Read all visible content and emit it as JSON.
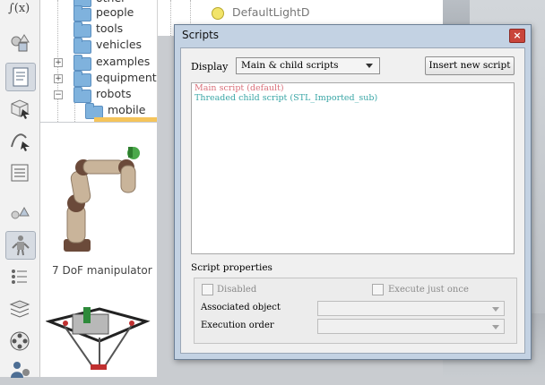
{
  "toolbar": {
    "items": [
      {
        "name": "script-function-icon",
        "label": "∫(x)"
      },
      {
        "name": "shapes-icon"
      },
      {
        "name": "script-page-icon"
      },
      {
        "name": "cube-select-icon"
      },
      {
        "name": "path-icon"
      },
      {
        "name": "properties-icon"
      },
      {
        "name": "primitives-icon"
      },
      {
        "name": "robot-icon"
      },
      {
        "name": "list-icon"
      },
      {
        "name": "layers-icon"
      },
      {
        "name": "film-icon"
      },
      {
        "name": "user-settings-icon"
      }
    ]
  },
  "tree": {
    "items": [
      {
        "label": "other",
        "expander": ""
      },
      {
        "label": "people",
        "expander": ""
      },
      {
        "label": "tools",
        "expander": ""
      },
      {
        "label": "vehicles",
        "expander": ""
      },
      {
        "label": "examples",
        "expander": "+"
      },
      {
        "label": "equipment",
        "expander": "+"
      },
      {
        "label": "robots",
        "expander": "−"
      },
      {
        "label": "mobile",
        "expander": ""
      }
    ]
  },
  "models": {
    "items": [
      {
        "caption": "7 DoF manipulator"
      }
    ]
  },
  "scene": {
    "item": "DefaultLightD"
  },
  "dialog": {
    "title": "Scripts",
    "close": "×",
    "display_label": "Display",
    "display_value": "Main & child scripts",
    "insert_button": "Insert new script",
    "scripts": [
      {
        "label": "Main script (default)",
        "color": "#d9707a"
      },
      {
        "label": "Threaded child script (STL_Imported_sub)",
        "color": "#3aa6a6"
      }
    ],
    "properties": {
      "title": "Script properties",
      "disabled_label": "Disabled",
      "execute_once_label": "Execute just once",
      "associated_label": "Associated object",
      "order_label": "Execution order"
    }
  }
}
